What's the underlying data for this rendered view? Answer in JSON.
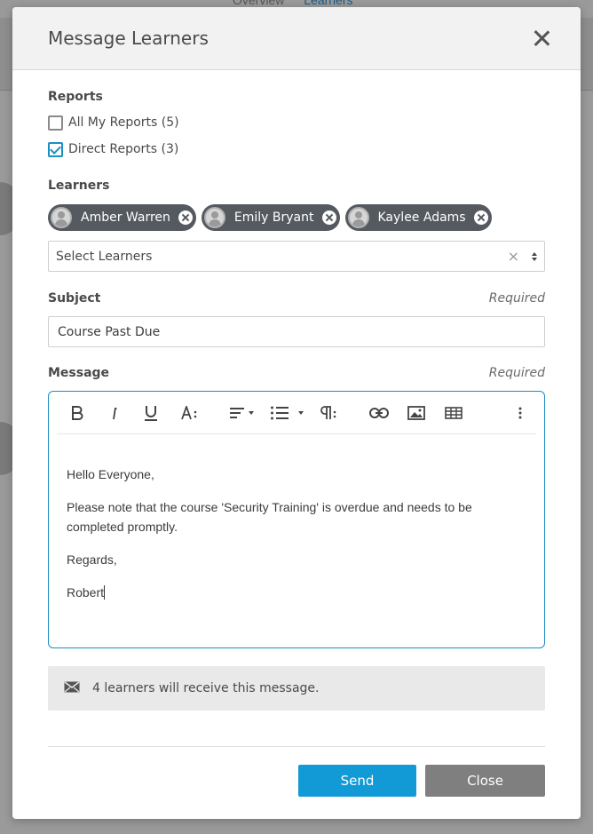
{
  "background": {
    "tabs": [
      "Overview",
      "Learners"
    ]
  },
  "modal": {
    "title": "Message Learners",
    "close_icon": "close-icon"
  },
  "reports": {
    "label": "Reports",
    "options": [
      {
        "label": "All My Reports (5)",
        "checked": false
      },
      {
        "label": "Direct Reports (3)",
        "checked": true
      }
    ]
  },
  "learners": {
    "label": "Learners",
    "selected": [
      {
        "name": "Amber Warren"
      },
      {
        "name": "Emily Bryant"
      },
      {
        "name": "Kaylee Adams"
      }
    ],
    "select_placeholder": "Select Learners",
    "clear_glyph": "×"
  },
  "subject": {
    "label": "Subject",
    "required": "Required",
    "value": "Course Past Due"
  },
  "message": {
    "label": "Message",
    "required": "Required",
    "toolbar": [
      "bold-icon",
      "italic-icon",
      "underline-icon",
      "font-size-icon",
      "align-icon",
      "list-icon",
      "paragraph-icon",
      "link-icon",
      "image-icon",
      "table-icon",
      "more-icon"
    ],
    "lines": [
      "Hello Everyone,",
      "Please note that the course 'Security Training' is overdue and needs to be completed promptly.",
      "Regards,",
      "Robert"
    ]
  },
  "notice": {
    "icon": "envelope-icon",
    "text": "4 learners will receive this message."
  },
  "footer": {
    "send_label": "Send",
    "close_label": "Close"
  },
  "colors": {
    "accent": "#129ad6",
    "chip_bg": "#555a60",
    "close_button": "#7f7f7f"
  }
}
